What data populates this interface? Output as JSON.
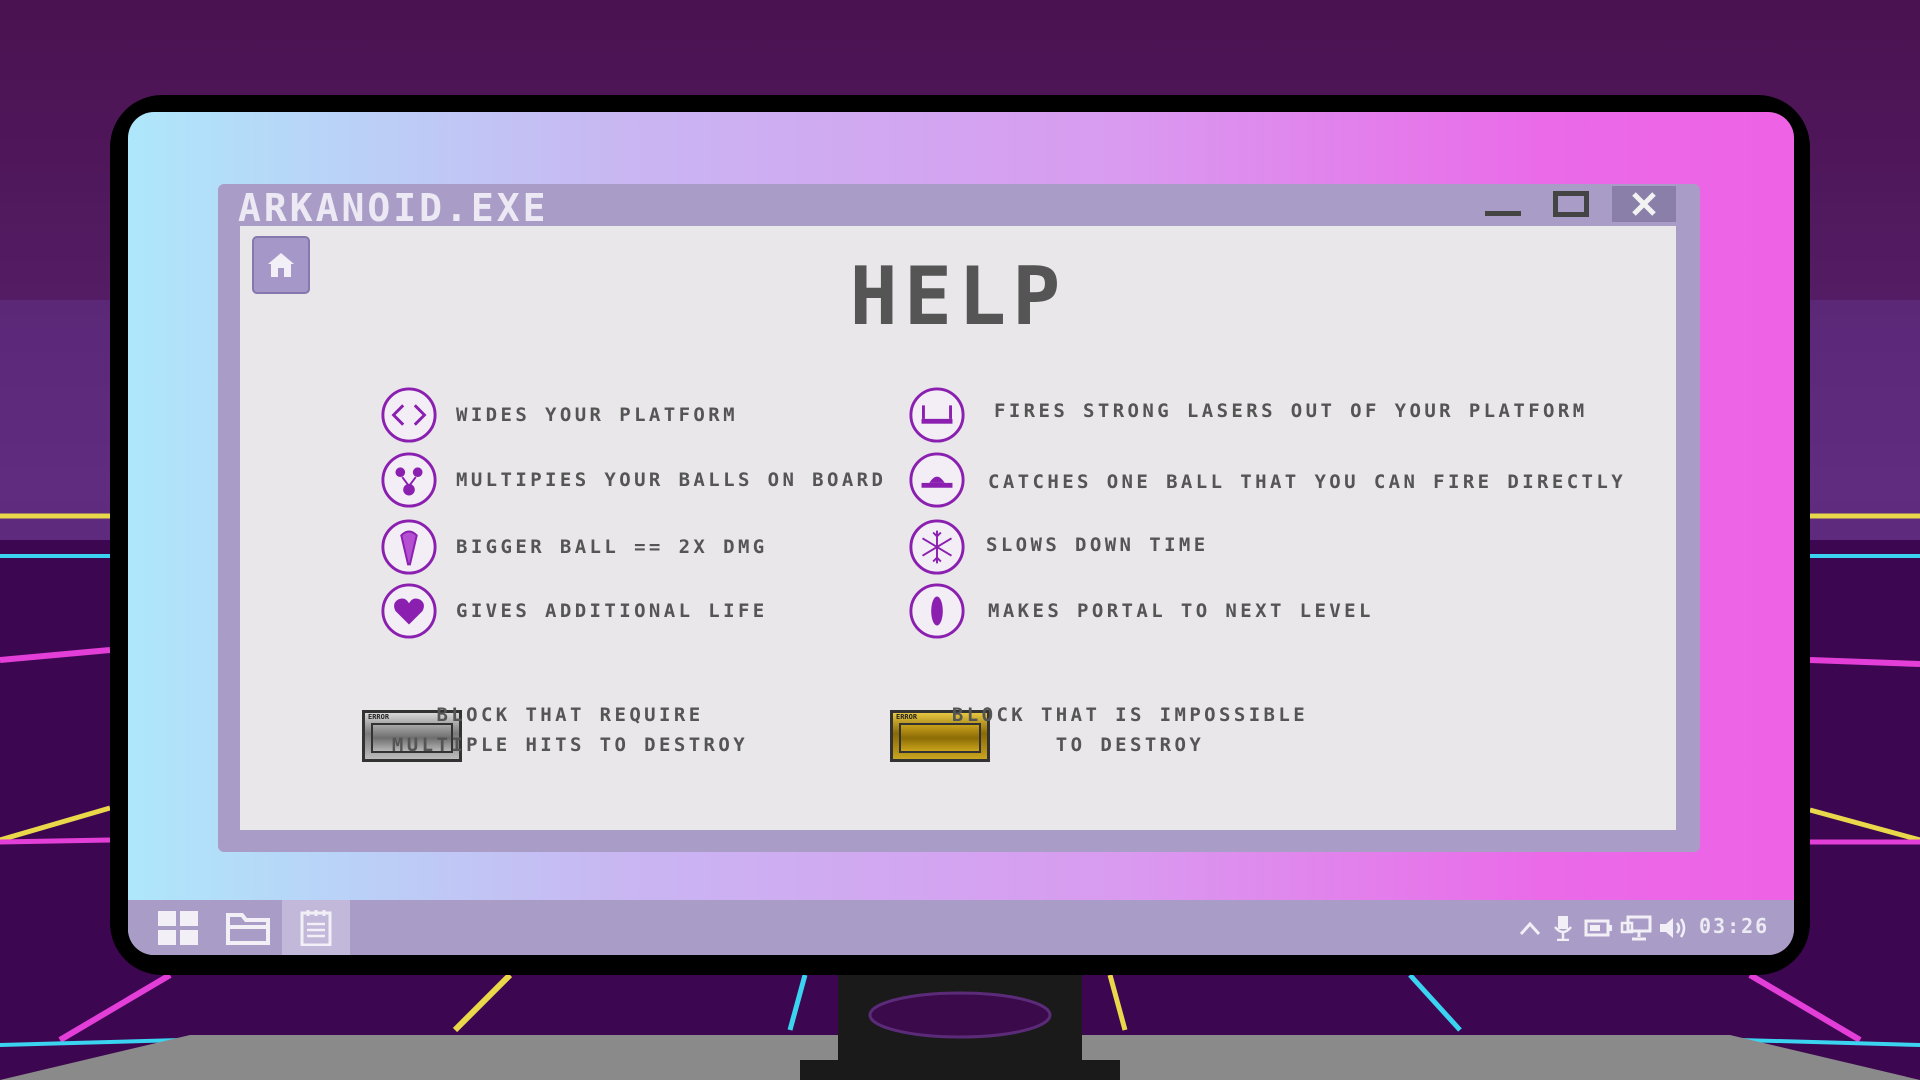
{
  "window": {
    "title": "ARKANOID.EXE"
  },
  "page": {
    "heading": "HELP"
  },
  "powerups_left": [
    {
      "icon": "widen-arrows-icon",
      "label": "WIDES YOUR PLATFORM"
    },
    {
      "icon": "multiball-icon",
      "label": "MULTIPIES YOUR BALLS ON BOARD"
    },
    {
      "icon": "big-ball-icon",
      "label": "BIGGER BALL == 2X DMG"
    },
    {
      "icon": "heart-icon",
      "label": "GIVES ADDITIONAL LIFE"
    }
  ],
  "powerups_right": [
    {
      "icon": "laser-icon",
      "label": "FIRES STRONG LASERS OUT OF YOUR PLATFORM"
    },
    {
      "icon": "catch-icon",
      "label": "CATCHES ONE BALL THAT YOU CAN FIRE DIRECTLY"
    },
    {
      "icon": "snowflake-icon",
      "label": "SLOWS DOWN TIME"
    },
    {
      "icon": "portal-icon",
      "label": "MAKES PORTAL TO NEXT LEVEL"
    }
  ],
  "blocks": [
    {
      "badge": "ERROR",
      "line1": "BLOCK THAT REQUIRE",
      "line2": "MULTIPLE HITS TO DESTROY",
      "color": "#8f8f8f"
    },
    {
      "badge": "ERROR",
      "line1": "BLOCK THAT IS IMPOSSIBLE",
      "line2": "TO DESTROY",
      "color": "#b8940f"
    }
  ],
  "taskbar": {
    "clock": "03:26"
  },
  "colors": {
    "accent_purple": "#8a1fb0",
    "window_frame": "#a99dc7",
    "content_bg": "#e9e7ea"
  }
}
